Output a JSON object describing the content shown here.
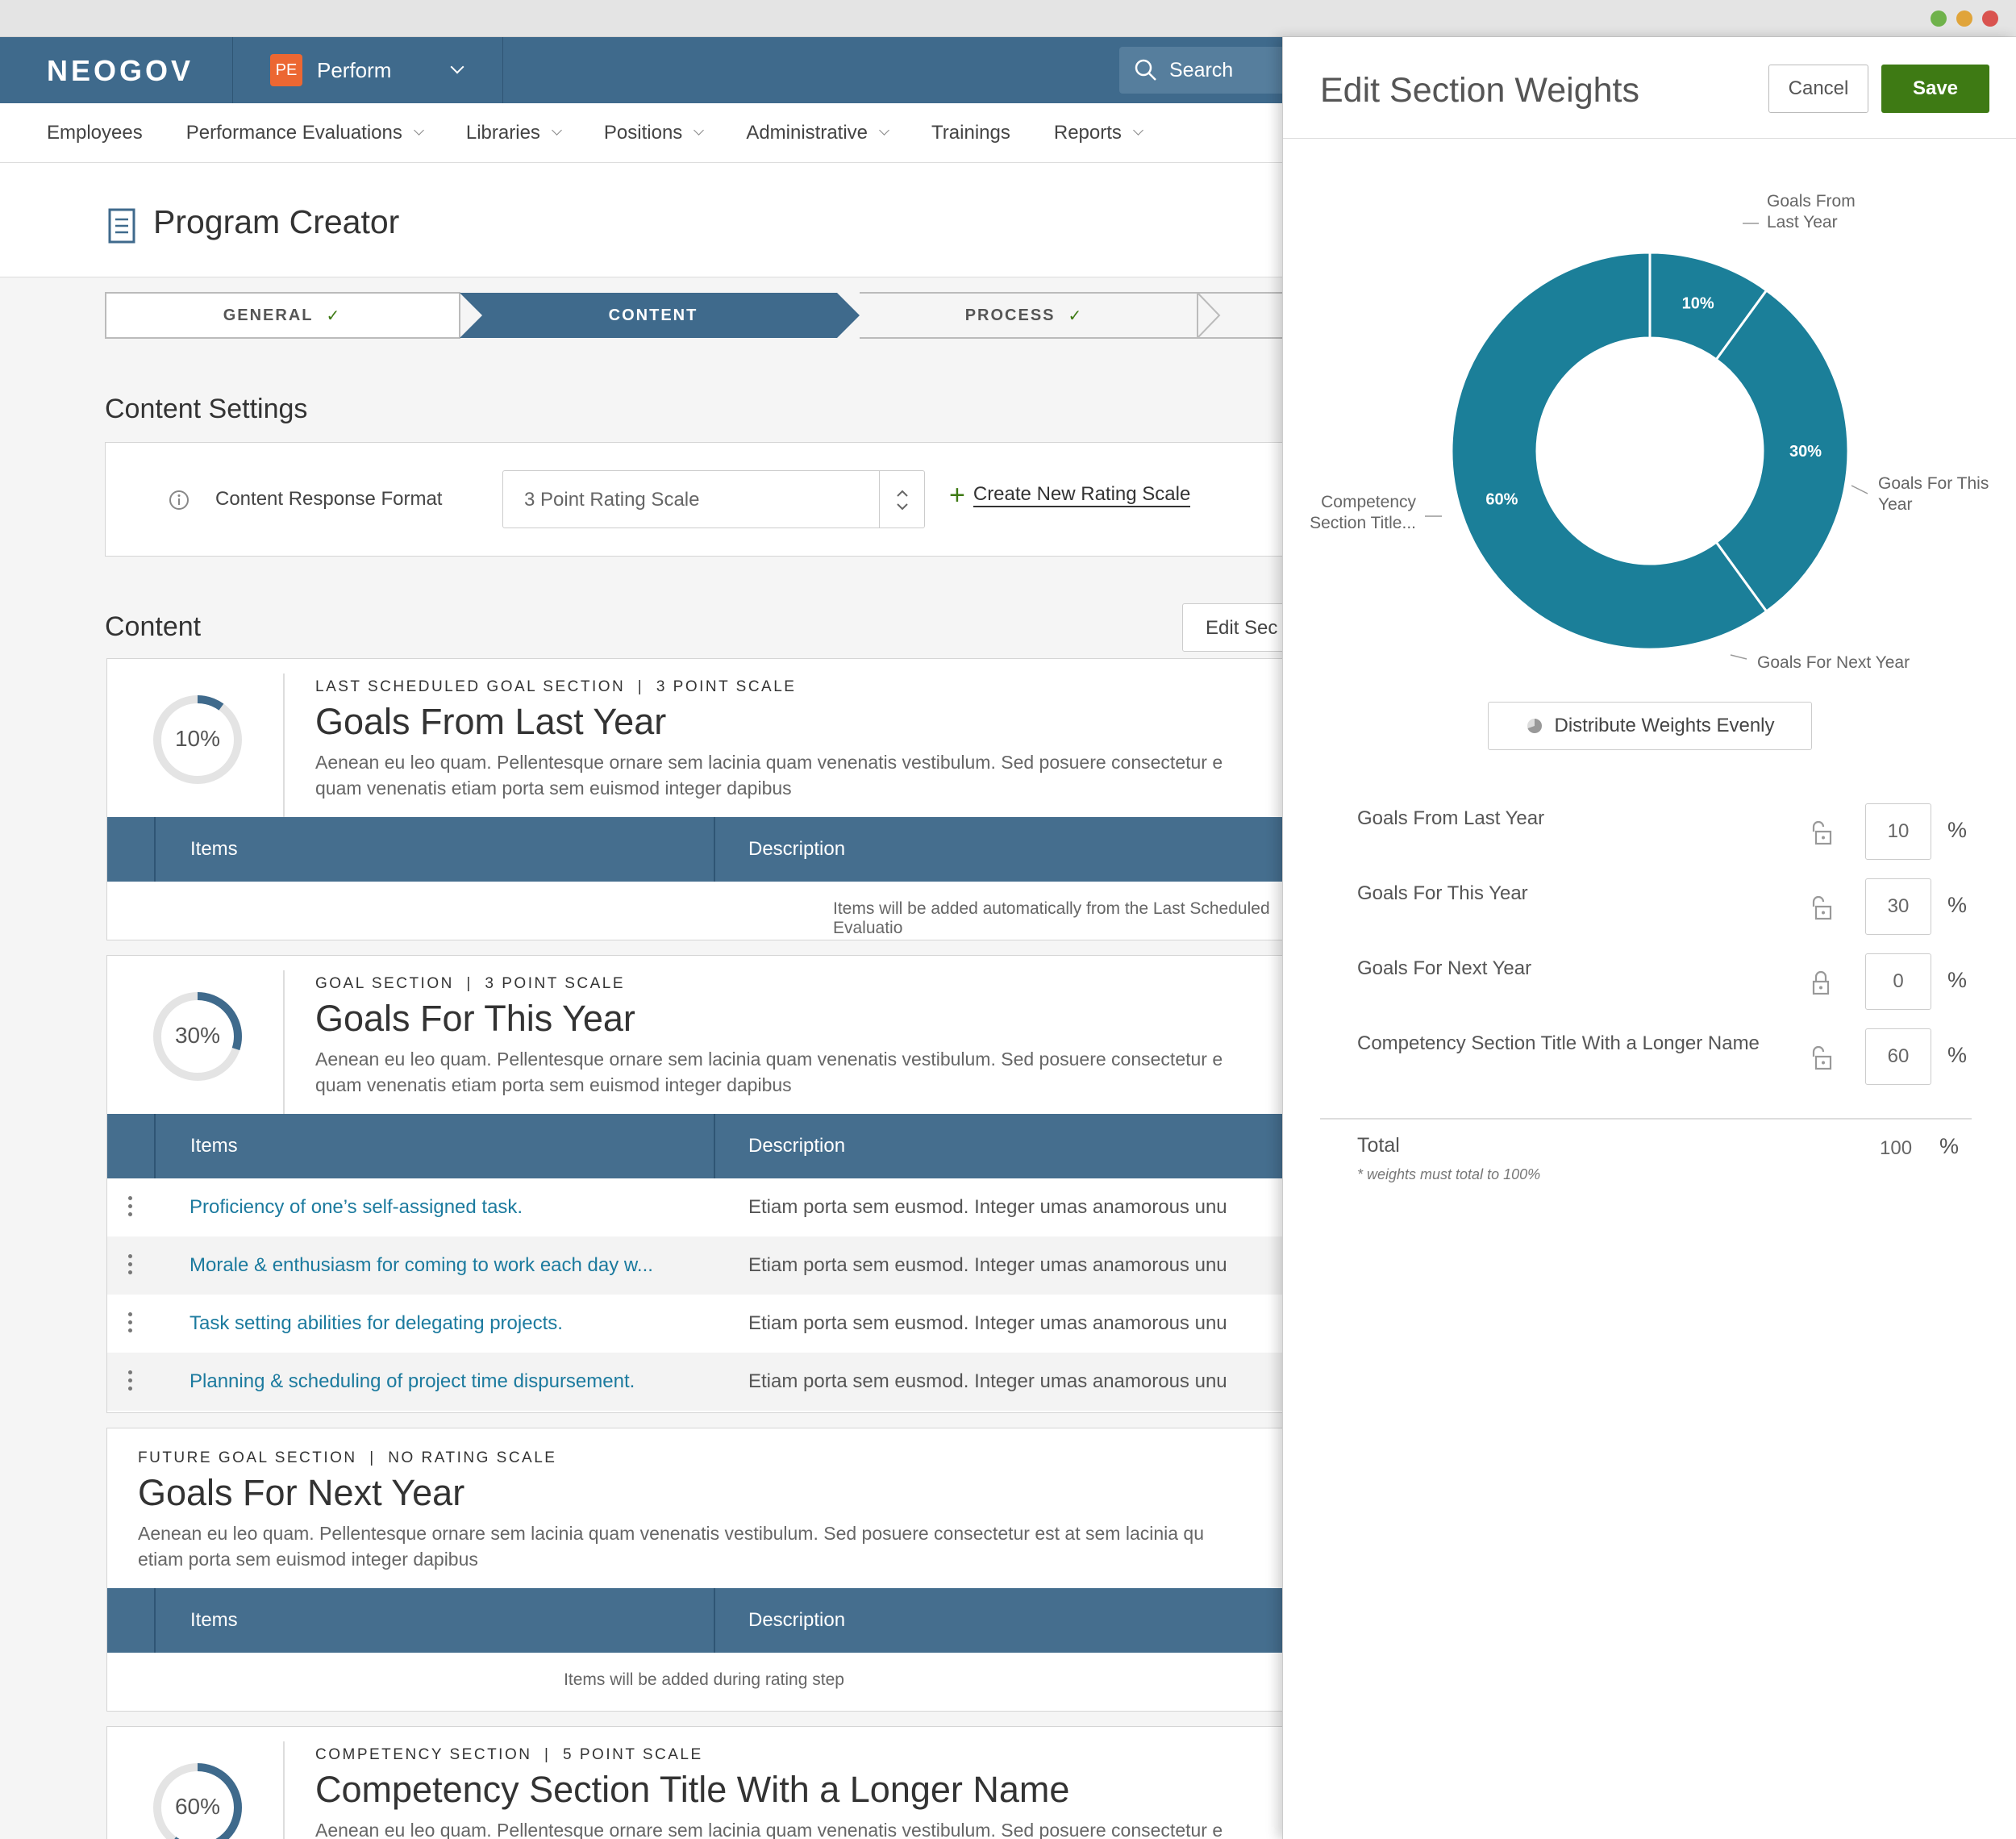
{
  "brand": {
    "logo": "NEOGOV",
    "product_badge": "PE",
    "product_name": "Perform"
  },
  "search": {
    "placeholder": "Search"
  },
  "nav": {
    "items": [
      "Employees",
      "Performance Evaluations",
      "Libraries",
      "Positions",
      "Administrative",
      "Trainings",
      "Reports"
    ]
  },
  "page": {
    "title": "Program Creator"
  },
  "steps": [
    {
      "label": "GENERAL",
      "done": true
    },
    {
      "label": "CONTENT",
      "done": false,
      "active": true
    },
    {
      "label": "PROCESS",
      "done": true
    }
  ],
  "content_settings": {
    "heading": "Content Settings",
    "label": "Content Response Format",
    "select_value": "3 Point Rating Scale",
    "create_link": "Create New Rating Scale"
  },
  "content": {
    "heading": "Content",
    "edit_button": "Edit Sec"
  },
  "table_headers": {
    "items": "Items",
    "description": "Description"
  },
  "sections": [
    {
      "type": "LAST SCHEDULED GOAL SECTION",
      "scale": "3 POINT SCALE",
      "title": "Goals From Last Year",
      "pct_label": "10%",
      "pct": 0.1,
      "desc1": "Aenean eu leo quam. Pellentesque ornare sem lacinia quam venenatis vestibulum. Sed posuere consectetur e",
      "desc2": "quam venenatis etiam porta sem euismod integer dapibus",
      "empty_text": "Items will be added automatically from the Last Scheduled Evaluatio"
    },
    {
      "type": "GOAL SECTION",
      "scale": "3 POINT SCALE",
      "title": "Goals For This Year",
      "pct_label": "30%",
      "pct": 0.3,
      "desc1": "Aenean eu leo quam. Pellentesque ornare sem lacinia quam venenatis vestibulum. Sed posuere consectetur e",
      "desc2": "quam venenatis etiam porta sem euismod integer dapibus",
      "rows": [
        {
          "name": "Proficiency of one’s self-assigned task.",
          "desc": "Etiam porta sem eusmod. Integer umas anamorous unu"
        },
        {
          "name": "Morale & enthusiasm for coming to work each day w...",
          "desc": "Etiam porta sem eusmod. Integer umas anamorous unu"
        },
        {
          "name": "Task setting abilities for delegating projects.",
          "desc": "Etiam porta sem eusmod. Integer umas anamorous unu"
        },
        {
          "name": "Planning & scheduling of project time dispursement.",
          "desc": "Etiam porta sem eusmod. Integer umas anamorous unu"
        }
      ]
    },
    {
      "type": "FUTURE GOAL SECTION",
      "scale": "NO RATING SCALE",
      "title": "Goals For Next Year",
      "desc1": "Aenean eu leo quam. Pellentesque ornare sem lacinia quam venenatis vestibulum. Sed posuere consectetur est at sem lacinia qu",
      "desc2": "etiam porta sem euismod integer dapibus",
      "empty_text": "Items will be added during rating step"
    },
    {
      "type": "COMPETENCY SECTION",
      "scale": "5 POINT SCALE",
      "title": "Competency Section Title With a Longer Name",
      "pct_label": "60%",
      "pct": 0.6,
      "desc1": "Aenean eu leo quam. Pellentesque ornare sem lacinia quam venenatis vestibulum. Sed posuere consectetur e"
    }
  ],
  "panel": {
    "title": "Edit Section Weights",
    "cancel": "Cancel",
    "save": "Save",
    "distribute": "Distribute Weights Evenly",
    "total_label": "Total",
    "total_value": "100",
    "total_pct": "%",
    "note": "* weights must total to 100%"
  },
  "chart_data": {
    "type": "pie",
    "subtype": "donut",
    "categories": [
      "Goals From Last Year",
      "Goals For This Year",
      "Goals For Next Year",
      "Competency Section Title With a Longer Name"
    ],
    "values": [
      10,
      30,
      0,
      60
    ],
    "slice_labels": [
      "10%",
      "30%",
      "",
      "60%"
    ],
    "callout_labels": [
      "Goals From Last Year",
      "Goals For This Year",
      "Goals For Next Year",
      "Competency Section Title..."
    ],
    "color": "#1b7f99"
  },
  "weights": [
    {
      "name": "Goals From Last Year",
      "value": "10",
      "pct": "%",
      "locked": false
    },
    {
      "name": "Goals For This Year",
      "value": "30",
      "pct": "%",
      "locked": false
    },
    {
      "name": "Goals For Next Year",
      "value": "0",
      "pct": "%",
      "locked": true
    },
    {
      "name": "Competency Section Title With a Longer Name",
      "value": "60",
      "pct": "%",
      "locked": false
    }
  ],
  "colors": {
    "header": "#3f6a8c",
    "table_header": "#456e8e",
    "accent": "#1b7a9e",
    "chart": "#1b7f99",
    "save": "#3e7a14",
    "badge": "#ec6732"
  }
}
